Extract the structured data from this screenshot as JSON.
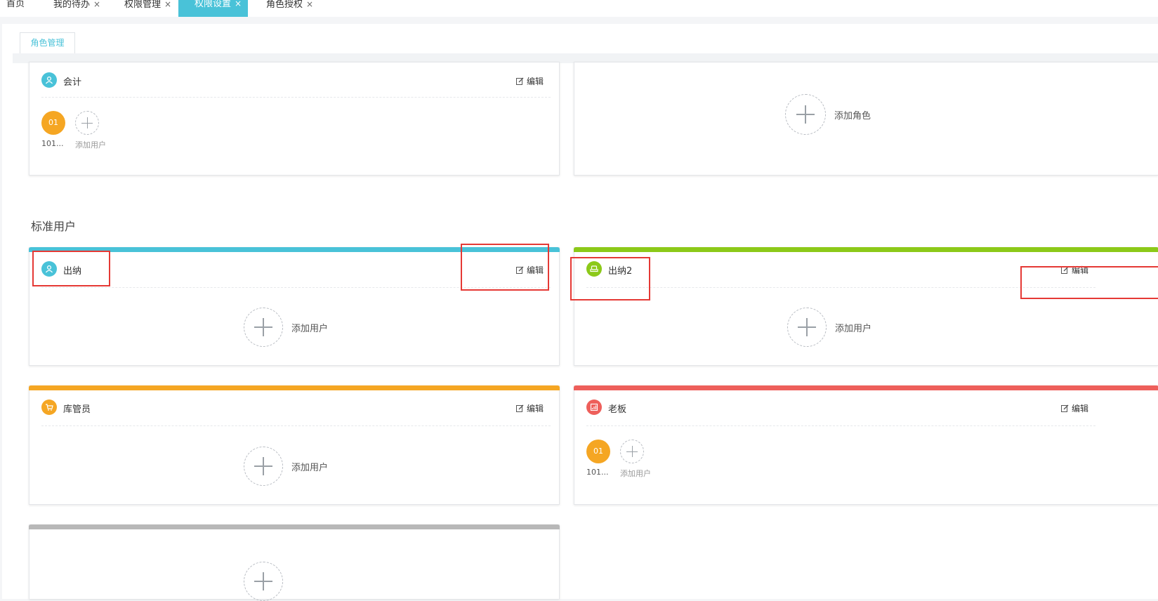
{
  "top_tabs": [
    {
      "label": "首页",
      "closable": false
    },
    {
      "label": "我的待办",
      "closable": true
    },
    {
      "label": "权限管理",
      "closable": true
    },
    {
      "label": "权限设置",
      "closable": true,
      "active": true
    },
    {
      "label": "角色授权",
      "closable": true
    }
  ],
  "close_glyph": "×",
  "sub_tab": {
    "label": "角色管理"
  },
  "edit_label": "编辑",
  "add_role_label": "添加角色",
  "add_user_label": "添加用户",
  "section_standard": "标准用户",
  "roles": {
    "kuaiji": {
      "name": "会计",
      "color": "#49c2d8",
      "icon": "user-icon",
      "users": [
        {
          "avatar": "01",
          "name": "101..."
        }
      ]
    },
    "chuna": {
      "name": "出纳",
      "color": "#49c2d8",
      "icon": "user-icon"
    },
    "chuna2": {
      "name": "出纳2",
      "color": "#8cc919",
      "icon": "sofa-icon"
    },
    "kuguanyuan": {
      "name": "库管员",
      "color": "#f5a623",
      "icon": "cart-icon"
    },
    "laoban": {
      "name": "老板",
      "color": "#ee5f5b",
      "icon": "chart-icon",
      "users": [
        {
          "avatar": "01",
          "name": "101..."
        }
      ]
    },
    "unnamed": {
      "color": "#b8b8b8"
    }
  }
}
